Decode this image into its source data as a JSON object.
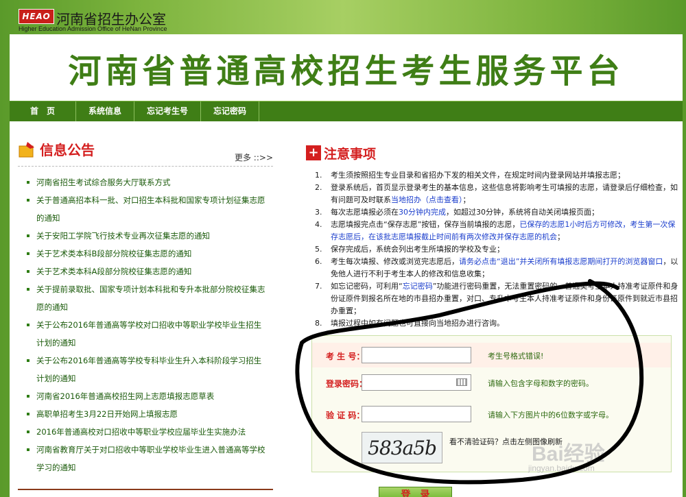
{
  "header": {
    "logo_text": "HEAO",
    "office_name_cn": "河南省招生办公室",
    "office_name_en": "Higher Education Admission Office of HeNan Province"
  },
  "banner": {
    "title": "河南省普通高校招生考生服务平台"
  },
  "nav": {
    "items": [
      "首　页",
      "系统信息",
      "忘记考生号",
      "忘记密码"
    ]
  },
  "info": {
    "title": "信息公告",
    "more_label": "更多 ::>>",
    "items": [
      "河南省招生考试综合服务大厅联系方式",
      "关于普通高招本科一批、对口招生本科批和国家专项计划征集志愿的通知",
      "关于安阳工学院飞行技术专业再次征集志愿的通知",
      "关于艺术类本科B段部分院校征集志愿的通知",
      "关于艺术类本科A段部分院校征集志愿的通知",
      "关于提前录取批、国家专项计划本科批和专升本批部分院校征集志愿的通知",
      "关于公布2016年普通高等学校对口招收中等职业学校毕业生招生计划的通知",
      "关于公布2016年普通高等学校专科毕业生升入本科阶段学习招生计划的通知",
      "河南省2016年普通高校招生网上志愿填报志愿草表",
      "高职单招考生3月22日开始网上填报志愿",
      "2016年普通高校对口招收中等职业学校应届毕业生实施办法",
      "河南省教育厅关于对口招收中等职业学校毕业生进入普通高等学校学习的通知"
    ]
  },
  "notice": {
    "title": "注意事项",
    "rules": [
      {
        "num": "1.",
        "parts": [
          [
            "",
            "考生须按照招生专业目录和省招办下发的相关文件，在规定时间内登录网站并填报志愿；"
          ]
        ]
      },
      {
        "num": "2.",
        "parts": [
          [
            "",
            "登录系统后，首页显示登录考生的基本信息，这些信息将影响考生可填报的志愿，请登录后仔细检查，如有问题可及时联系"
          ],
          [
            "blue",
            "当地招办（点击查看）"
          ],
          [
            "",
            "；"
          ]
        ]
      },
      {
        "num": "3.",
        "parts": [
          [
            "",
            "每次志愿填报必须在"
          ],
          [
            "blue",
            "30分钟内完成"
          ],
          [
            "",
            "，如超过30分钟，系统将自动关闭填报页面；"
          ]
        ]
      },
      {
        "num": "4.",
        "parts": [
          [
            "",
            "志愿填报完点击“保存志愿”按钮，保存当前填报的志愿，"
          ],
          [
            "blue",
            "已保存的志愿1小时后方可修改，考生第一次保存志愿后，在该批志愿填报截止时间前有两次修改并保存志愿的机会"
          ],
          [
            "",
            "；"
          ]
        ]
      },
      {
        "num": "5.",
        "parts": [
          [
            "",
            "保存完成后，系统会列出考生所填报的学校及专业；"
          ]
        ]
      },
      {
        "num": "6.",
        "parts": [
          [
            "",
            "考生每次填报、修改或浏览完志愿后，"
          ],
          [
            "blue",
            "请务必点击“退出”并关闭所有填报志愿期间打开的浏览器窗口"
          ],
          [
            "",
            "，以免他人进行不利于考生本人的修改和信息收集；"
          ]
        ]
      },
      {
        "num": "7.",
        "parts": [
          [
            "",
            "如忘记密码，可利用“"
          ],
          [
            "blue",
            "忘记密码"
          ],
          [
            "",
            "”功能进行密码重置，无法重置密码的，普通类考生本人持准考证原件和身份证原件到报名所在地的市县招办重置，对口、专升本考生本人持准考证原件和身份证原件到就近市县招办重置；"
          ]
        ]
      },
      {
        "num": "8.",
        "parts": [
          [
            "",
            "填报过程中如有问题也可直接向当地招办进行咨询。"
          ]
        ]
      }
    ]
  },
  "login": {
    "exam_label": "考 生 号：",
    "exam_value": "",
    "exam_hint": "考生号格式错误!",
    "password_label": "登录密码：",
    "password_hint": "请输入包含字母和数字的密码。",
    "captcha_label": "验 证 码：",
    "captcha_hint": "请输入下方图片中的6位数字或字母。",
    "captcha_text": "583a5b",
    "captcha_tip": "看不清验证码？点击左侧图像刷新",
    "submit_label": "登　录"
  },
  "watermark": {
    "brand": "Bai经验",
    "url": "jingyan.baidu.com"
  },
  "colors": {
    "accent": "#3f7e16",
    "alert": "#d41f1f",
    "link": "#1a3dcc"
  }
}
